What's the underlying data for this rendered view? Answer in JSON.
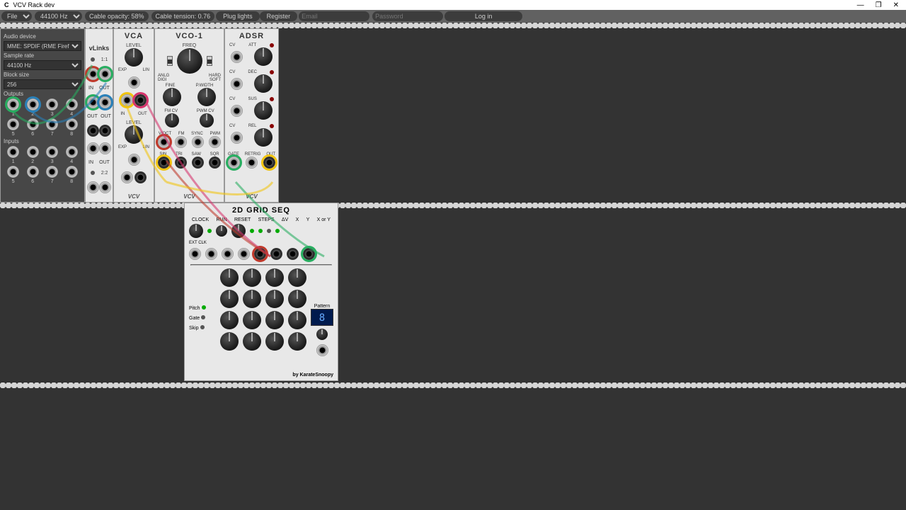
{
  "window": {
    "title": "VCV Rack dev"
  },
  "toolbar": {
    "file": "File",
    "sr_sel": "44100 Hz",
    "opacity": "Cable opacity: 58%",
    "tension": "Cable tension: 0.76",
    "plug_lights": "Plug lights",
    "register": "Register",
    "email_ph": "Email",
    "pass_ph": "Password",
    "login": "Log in"
  },
  "audio": {
    "device_label": "Audio device",
    "device": "MME: SPDIF (RME Firef...",
    "sr_label": "Sample rate",
    "sr": "44100 Hz",
    "bs_label": "Block size",
    "bs": "256",
    "outputs_label": "Outputs",
    "inputs_label": "Inputs",
    "nums1": [
      "1",
      "2",
      "3",
      "4"
    ],
    "nums2": [
      "5",
      "6",
      "7",
      "8"
    ]
  },
  "vlinks": {
    "title": "vLinks",
    "labels": [
      "IN",
      "OUT",
      "OUT",
      "OUT",
      "IN",
      "OUT"
    ],
    "ratios": [
      "1:1",
      "2:2"
    ]
  },
  "vca": {
    "title": "VCA",
    "level": "LEVEL",
    "exp": "EXP",
    "lin": "LIN",
    "in": "IN",
    "out": "OUT"
  },
  "vco": {
    "title": "VCO-1",
    "freq": "FREQ",
    "anlg": "ANLG",
    "hard": "HARD",
    "digi": "DIGI",
    "soft": "SOFT",
    "fine": "FINE",
    "pwidth": "P.WIDTH",
    "fmcv": "FM CV",
    "pwmcv": "PWM CV",
    "voct": "V/OCT",
    "fm": "FM",
    "sync": "SYNC",
    "pwm": "PWM",
    "sin": "SIN",
    "tri": "TRI",
    "saw": "SAW",
    "sqr": "SQR"
  },
  "adsr": {
    "title": "ADSR",
    "att": "ATT",
    "dec": "DEC",
    "sus": "SUS",
    "rel": "REL",
    "cv": "CV",
    "gate": "GATE",
    "retrig": "RETRIG",
    "out": "OUT"
  },
  "gridseq": {
    "title": "2D GRID SEQ",
    "clock": "CLOCK",
    "run": "RUN",
    "reset": "RESET",
    "steps": "STEPS",
    "xv": "ΔV",
    "x": "X",
    "y": "Y",
    "xory": "X or Y",
    "extclk": "EXT CLK",
    "pitch": "Pitch",
    "gate": "Gate",
    "skip": "Skip",
    "pattern": "Pattern",
    "patval": "8",
    "author": "by KarateSnoopy"
  },
  "brand": "VCV"
}
